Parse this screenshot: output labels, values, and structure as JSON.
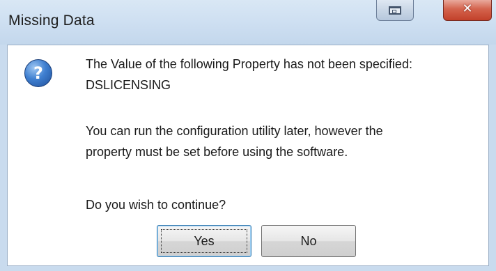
{
  "window": {
    "title": "Missing Data"
  },
  "message": {
    "line1": "The Value of the following Property has not been specified:",
    "property": "DSLICENSING",
    "info_line1": "You can run the configuration utility later, however the",
    "info_line2": "property must be set before using the software.",
    "question": "Do you wish to continue?"
  },
  "buttons": {
    "yes": "Yes",
    "no": "No"
  },
  "icons": {
    "dialog_icon": "question-icon",
    "restore": "restore-icon",
    "close": "close-icon"
  },
  "colors": {
    "close_button": "#c2412a",
    "question_icon": "#3f7fd0"
  }
}
